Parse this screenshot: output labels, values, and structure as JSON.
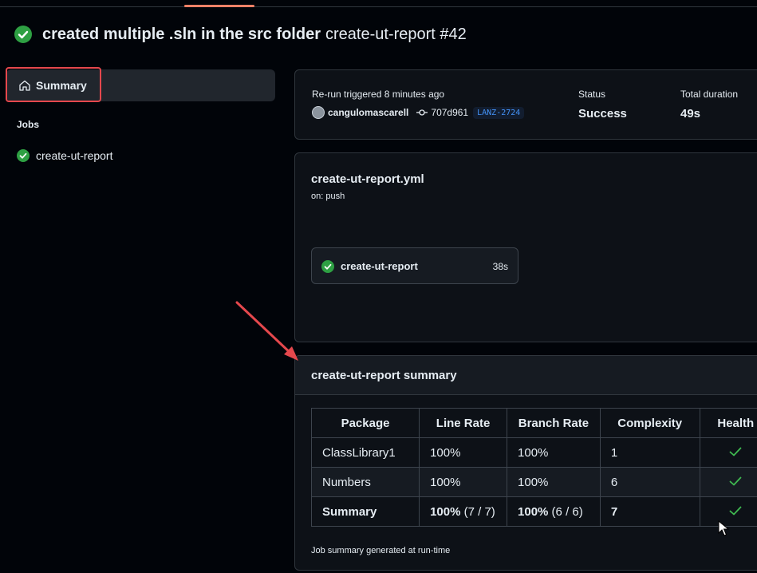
{
  "header": {
    "title": "created multiple .sln in the src folder",
    "run_name": "create-ut-report #42",
    "status_icon": "check-circle-icon"
  },
  "sidebar": {
    "summary_label": "Summary",
    "jobs_heading": "Jobs",
    "jobs": [
      {
        "label": "create-ut-report",
        "status": "success"
      }
    ]
  },
  "run_info": {
    "trigger_text": "Re-run triggered 8 minutes ago",
    "actor": "cangulomascarell",
    "commit_sha": "707d961",
    "branch": "LANZ-2724",
    "status_label": "Status",
    "status_value": "Success",
    "duration_label": "Total duration",
    "duration_value": "49s"
  },
  "workflow": {
    "file": "create-ut-report.yml",
    "trigger": "on: push",
    "job_name": "create-ut-report",
    "job_duration": "38s"
  },
  "summary": {
    "title": "create-ut-report summary",
    "columns": [
      "Package",
      "Line Rate",
      "Branch Rate",
      "Complexity",
      "Health"
    ],
    "rows": [
      {
        "package": "ClassLibrary1",
        "line_rate": "100%",
        "branch_rate": "100%",
        "complexity": "1"
      },
      {
        "package": "Numbers",
        "line_rate": "100%",
        "branch_rate": "100%",
        "complexity": "6"
      }
    ],
    "total": {
      "package": "Summary",
      "line_rate": "100%",
      "line_detail": " (7 / 7)",
      "branch_rate": "100%",
      "branch_detail": " (6 / 6)",
      "complexity": "7"
    },
    "footer": "Job summary generated at run-time"
  },
  "colors": {
    "background": "#010409",
    "success": "#2ea043",
    "accent": "#f78166",
    "highlight_annotation": "#e5484d"
  }
}
